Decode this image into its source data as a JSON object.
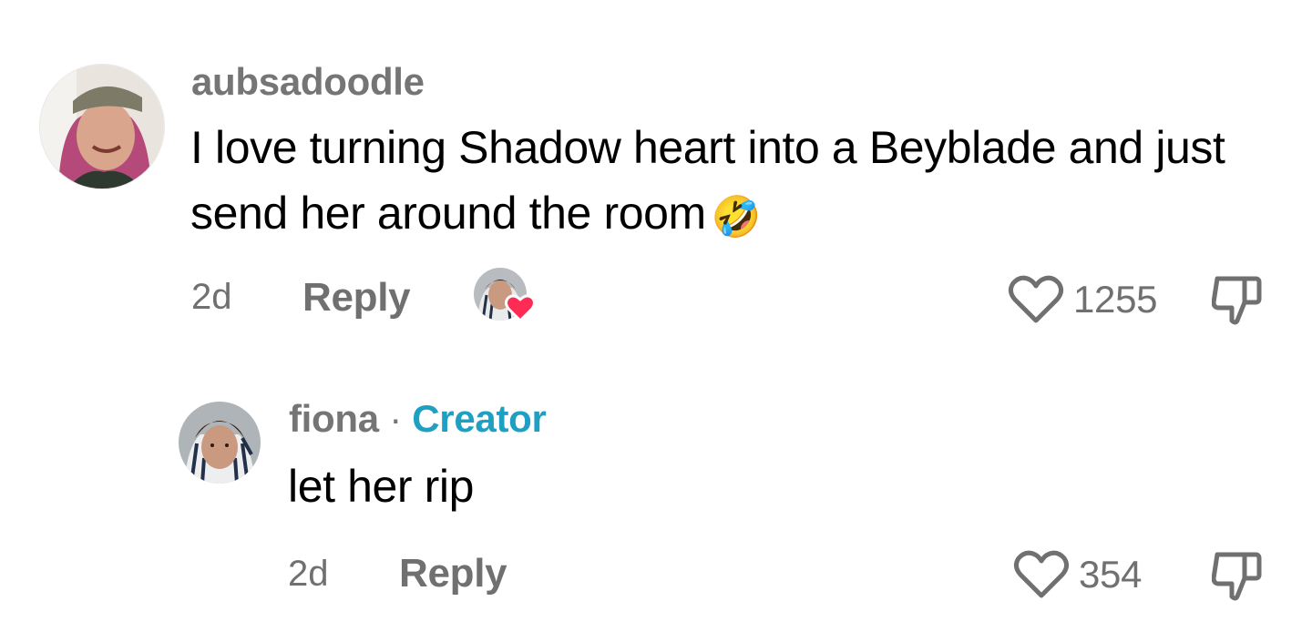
{
  "comments": [
    {
      "username": "aubsadoodle",
      "text": "I love turning Shadow heart into a Beyblade and just send her around the room",
      "emoji": "🤣",
      "time": "2d",
      "reply_label": "Reply",
      "likes": "1255",
      "liked_by_creator": true
    },
    {
      "username": "fiona",
      "separator": "·",
      "badge": "Creator",
      "text": "let her rip",
      "time": "2d",
      "reply_label": "Reply",
      "likes": "354"
    }
  ],
  "colors": {
    "creator_badge": "#1EA0C3",
    "meta_gray": "#707070",
    "heart_red": "#FE2C55"
  }
}
